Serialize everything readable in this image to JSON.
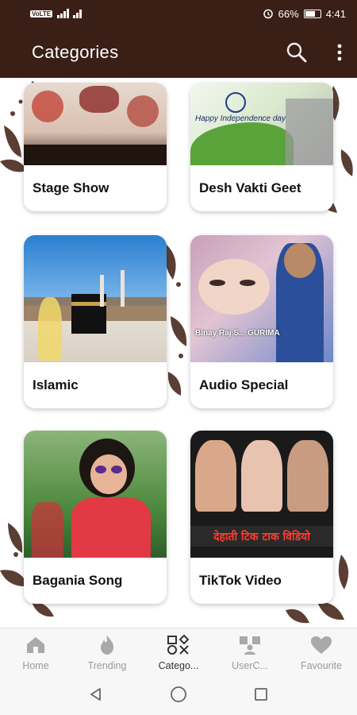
{
  "status": {
    "left_text": "VoLTE",
    "battery": "66%",
    "time": "4:41"
  },
  "app_bar": {
    "title": "Categories",
    "search_icon": "search-icon",
    "more_icon": "more-vertical-icon"
  },
  "categories": [
    {
      "label": "Stage Show"
    },
    {
      "label": "Desh Vakti Geet",
      "thumb_text": "Happy Independence day"
    },
    {
      "label": "Islamic"
    },
    {
      "label": "Audio Special",
      "thumb_text": "Binay Raj S... GURIMA"
    },
    {
      "label": "Bagania Song"
    },
    {
      "label": "TikTok Video",
      "thumb_text": "देहाती टिक टाक विडियो"
    }
  ],
  "bottom_nav": [
    {
      "label": "Home",
      "icon": "home-icon",
      "active": false
    },
    {
      "label": "Trending",
      "icon": "fire-icon",
      "active": false
    },
    {
      "label": "Catego...",
      "icon": "categories-icon",
      "active": true
    },
    {
      "label": "UserC...",
      "icon": "user-content-icon",
      "active": false
    },
    {
      "label": "Favourite",
      "icon": "heart-icon",
      "active": false
    }
  ],
  "colors": {
    "app_bar": "#3a1f17",
    "nav_active": "#333333",
    "nav_inactive": "#9a9a9a"
  }
}
